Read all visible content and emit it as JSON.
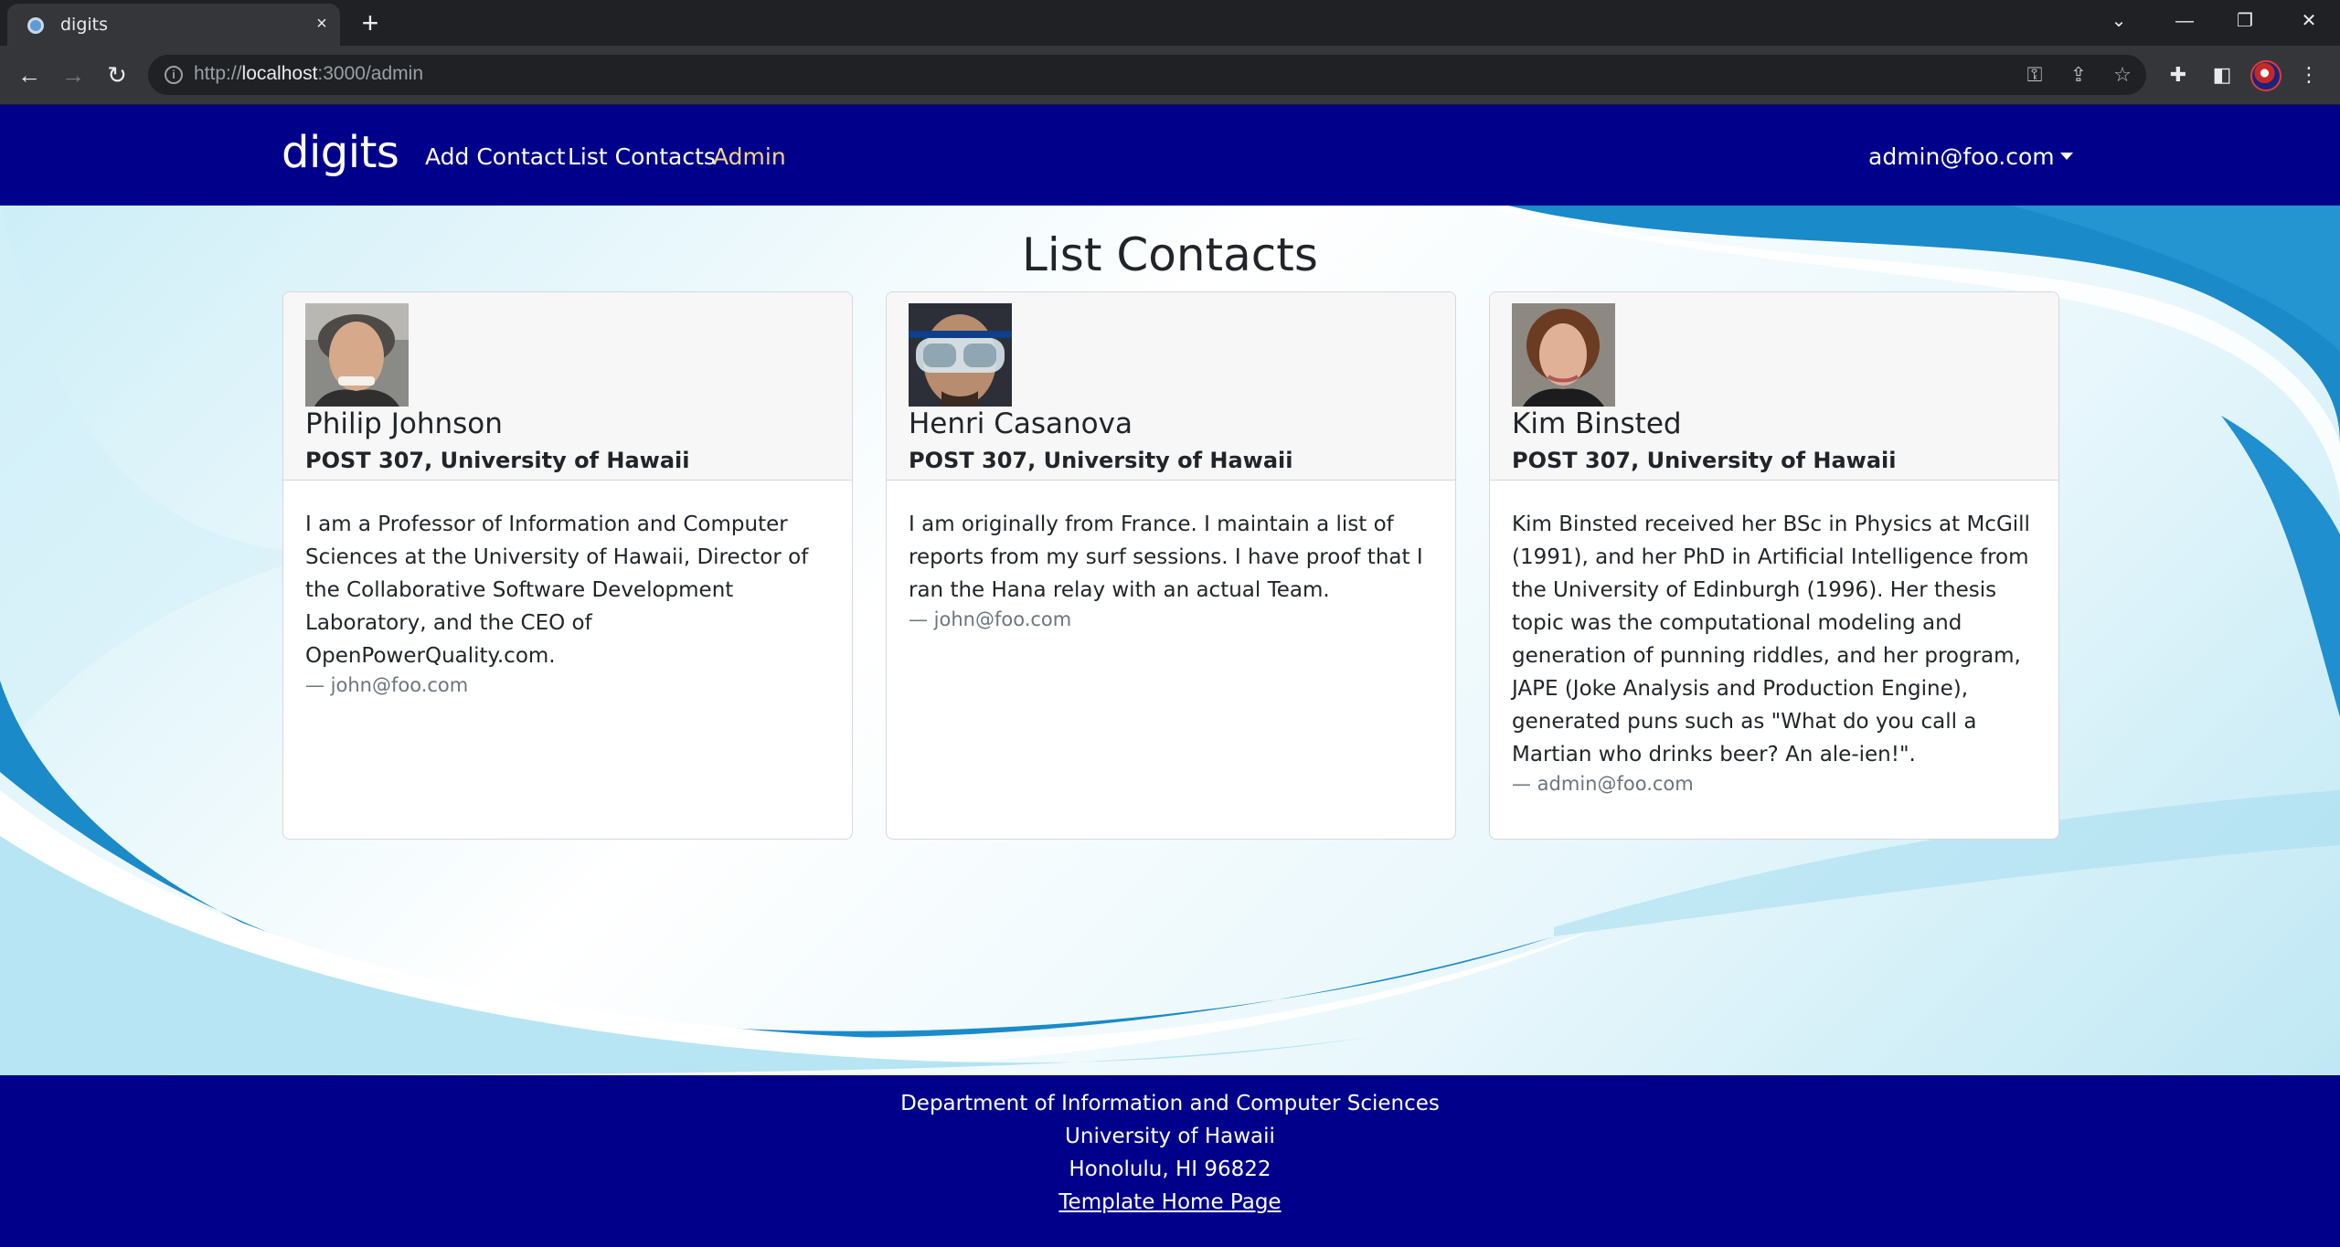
{
  "browser": {
    "tab_title": "digits",
    "url_prefix": "http://",
    "url_host": "localhost",
    "url_path": ":3000/admin",
    "icons": {
      "tab_close": "×",
      "new_tab": "+",
      "tab_search": "⌄",
      "minimize": "—",
      "restore": "❐",
      "close_window": "✕",
      "back": "←",
      "forward": "→",
      "reload": "↻",
      "info": "i",
      "key": "⚿",
      "share": "⇪",
      "star": "☆",
      "extensions": "✚",
      "side_panel": "◧",
      "menu": "⋮"
    }
  },
  "navbar": {
    "brand": "digits",
    "links": [
      "Add Contact",
      "List Contacts",
      "Admin"
    ],
    "active_link": "Admin",
    "user": "admin@foo.com",
    "color": "#00008b",
    "active_color": "#f0d58a"
  },
  "main": {
    "title": "List Contacts",
    "contacts": [
      {
        "name": "Philip Johnson",
        "address": "POST 307, University of Hawaii",
        "description": "I am a Professor of Information and Computer Sciences at the University of Hawaii, Director of the Collaborative Software Development Laboratory, and the CEO of OpenPowerQuality.com.",
        "owner": "— john@foo.com"
      },
      {
        "name": "Henri Casanova",
        "address": "POST 307, University of Hawaii",
        "description": "I am originally from France. I maintain a list of reports from my surf sessions. I have proof that I ran the Hana relay with an actual Team.",
        "owner": "— john@foo.com"
      },
      {
        "name": "Kim Binsted",
        "address": "POST 307, University of Hawaii",
        "description": "Kim Binsted received her BSc in Physics at McGill (1991), and her PhD in Artificial Intelligence from the University of Edinburgh (1996). Her thesis topic was the computational modeling and generation of punning riddles, and her program, JAPE (Joke Analysis and Production Engine), generated puns such as \"What do you call a Martian who drinks beer? An ale-ien!\".",
        "owner": "— admin@foo.com"
      }
    ]
  },
  "footer": {
    "line1": "Department of Information and Computer Sciences",
    "line2": "University of Hawaii",
    "line3": "Honolulu, HI 96822",
    "link": "Template Home Page"
  }
}
